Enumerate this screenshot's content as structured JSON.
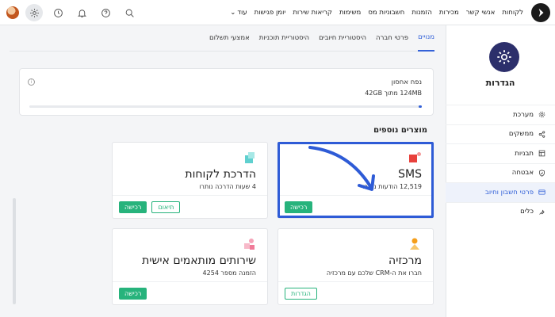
{
  "topbar": {
    "nav": [
      "לקוחות",
      "אנשי קשר",
      "מכירות",
      "הזמנות",
      "חשבוניות מס",
      "משימות",
      "קריאות שירות",
      "יומן פגישות"
    ],
    "more_label": "עוד"
  },
  "sidebar": {
    "title": "הגדרות",
    "items": [
      {
        "label": "מערכת",
        "icon": "gear-icon"
      },
      {
        "label": "ממשקים",
        "icon": "share-icon"
      },
      {
        "label": "תבניות",
        "icon": "template-icon"
      },
      {
        "label": "אבטחה",
        "icon": "shield-icon"
      },
      {
        "label": "פרטי חשבון וחיוב",
        "icon": "card-icon"
      },
      {
        "label": "כלים",
        "icon": "tools-icon"
      }
    ]
  },
  "tabs": [
    "מנויים",
    "פרטי חברה",
    "היסטוריית חיובים",
    "היסטוריית תוכניות",
    "אמצעי תשלום"
  ],
  "storage": {
    "title": "נפח אחסון",
    "value": "124MB מתוך 42GB",
    "usage_fraction": 0.003
  },
  "section_title": "מוצרים נוספים",
  "cards": {
    "sms": {
      "title": "SMS",
      "sub": "12,519 הודעות נותרו",
      "buy": "רכישה"
    },
    "training": {
      "title": "הדרכת לקוחות",
      "sub": "4 שעות הדרכה נותרו",
      "buy": "רכישה",
      "schedule": "תיאום"
    },
    "center": {
      "title": "מרכזיה",
      "sub": "חברו את ה-CRM שלכם עם מרכזיה",
      "settings": "הגדרות"
    },
    "custom": {
      "title": "שירותים מותאמים אישית",
      "sub": "הזמנה מספר 4254",
      "buy": "רכישה"
    }
  },
  "colors": {
    "accent": "#3462d8",
    "green": "#27b37c",
    "highlight": "#2e5bd6"
  }
}
